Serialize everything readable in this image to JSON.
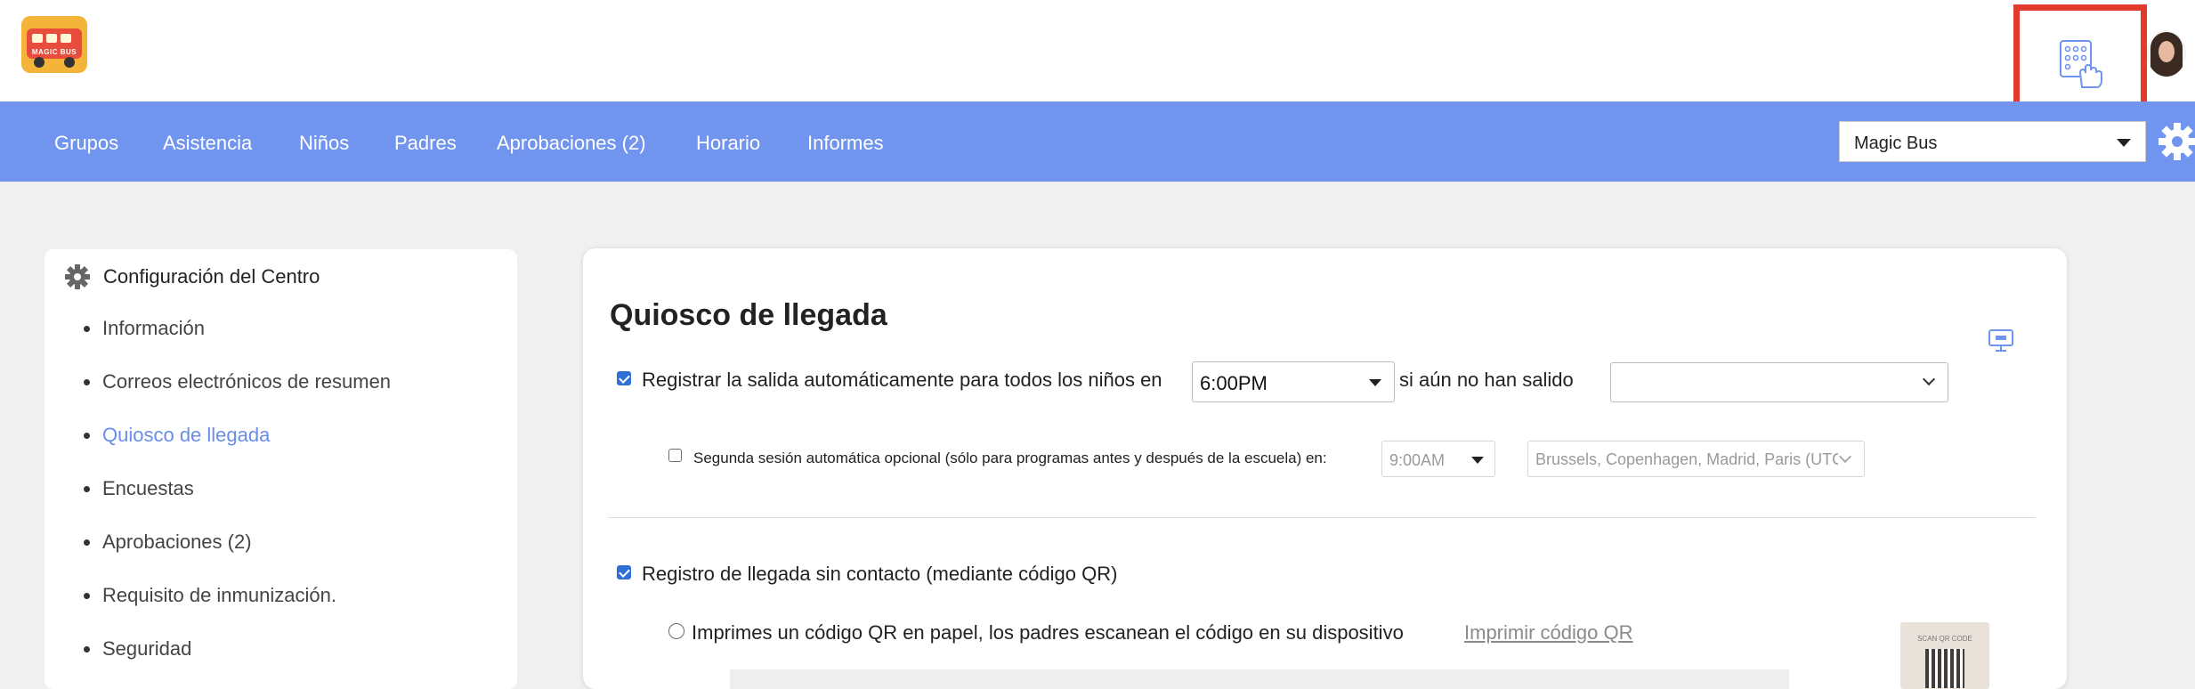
{
  "header": {
    "logo_alt": "MAGIC BUS"
  },
  "nav": {
    "items": [
      "Grupos",
      "Asistencia",
      "Niños",
      "Padres",
      "Aprobaciones (2)",
      "Horario",
      "Informes"
    ],
    "center_select": "Magic Bus"
  },
  "sidebar": {
    "title": "Configuración del Centro",
    "items": [
      {
        "label": "Información"
      },
      {
        "label": "Correos electrónicos de resumen"
      },
      {
        "label": "Quiosco de llegada"
      },
      {
        "label": "Encuestas"
      },
      {
        "label": "Aprobaciones (2)"
      },
      {
        "label": "Requisito de inmunización."
      },
      {
        "label": "Seguridad"
      }
    ],
    "active_index": 2
  },
  "main": {
    "title": "Quiosco de llegada",
    "auto_checkout": {
      "checked": true,
      "label_before": "Registrar la salida automáticamente para todos los niños en",
      "time": "6:00PM",
      "label_after": "si aún no han salido",
      "timezone": ""
    },
    "second_session": {
      "checked": false,
      "label": "Segunda sesión automática opcional (sólo para programas antes y después de la escuela) en:",
      "time": "9:00AM",
      "timezone": "Brussels, Copenhagen, Madrid, Paris (UTC"
    },
    "contactless": {
      "checked": true,
      "label": "Registro de llegada sin contacto (mediante código QR)"
    },
    "qr_option": {
      "label": "Imprimes un código QR en papel, los padres escanean el código en su dispositivo",
      "link": "Imprimir código QR",
      "thumb_caption": "SCAN QR CODE"
    }
  },
  "colors": {
    "nav_bg": "#7195ef",
    "active_link": "#6a8de6",
    "highlight_border": "#e23b2e"
  }
}
